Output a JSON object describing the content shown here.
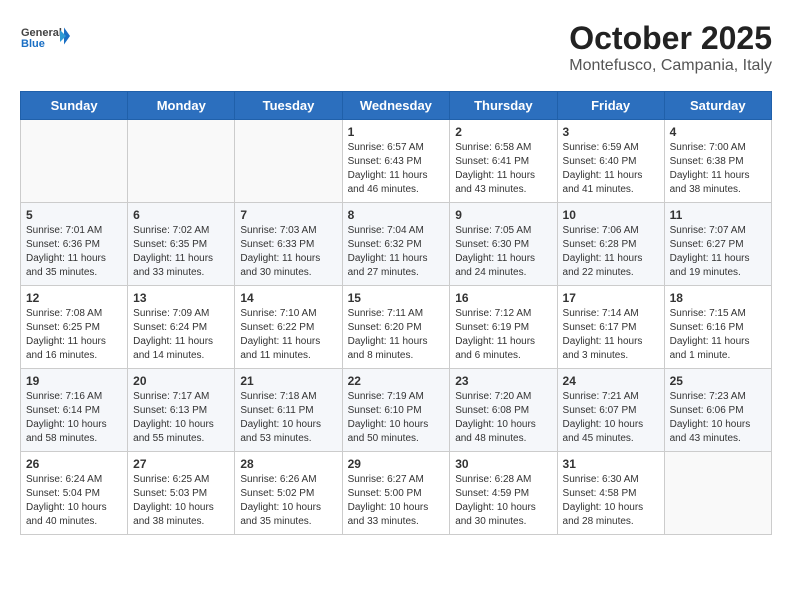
{
  "header": {
    "logo_general": "General",
    "logo_blue": "Blue",
    "title": "October 2025",
    "subtitle": "Montefusco, Campania, Italy"
  },
  "calendar": {
    "days_of_week": [
      "Sunday",
      "Monday",
      "Tuesday",
      "Wednesday",
      "Thursday",
      "Friday",
      "Saturday"
    ],
    "weeks": [
      [
        {
          "day": "",
          "info": ""
        },
        {
          "day": "",
          "info": ""
        },
        {
          "day": "",
          "info": ""
        },
        {
          "day": "1",
          "info": "Sunrise: 6:57 AM\nSunset: 6:43 PM\nDaylight: 11 hours and 46 minutes."
        },
        {
          "day": "2",
          "info": "Sunrise: 6:58 AM\nSunset: 6:41 PM\nDaylight: 11 hours and 43 minutes."
        },
        {
          "day": "3",
          "info": "Sunrise: 6:59 AM\nSunset: 6:40 PM\nDaylight: 11 hours and 41 minutes."
        },
        {
          "day": "4",
          "info": "Sunrise: 7:00 AM\nSunset: 6:38 PM\nDaylight: 11 hours and 38 minutes."
        }
      ],
      [
        {
          "day": "5",
          "info": "Sunrise: 7:01 AM\nSunset: 6:36 PM\nDaylight: 11 hours and 35 minutes."
        },
        {
          "day": "6",
          "info": "Sunrise: 7:02 AM\nSunset: 6:35 PM\nDaylight: 11 hours and 33 minutes."
        },
        {
          "day": "7",
          "info": "Sunrise: 7:03 AM\nSunset: 6:33 PM\nDaylight: 11 hours and 30 minutes."
        },
        {
          "day": "8",
          "info": "Sunrise: 7:04 AM\nSunset: 6:32 PM\nDaylight: 11 hours and 27 minutes."
        },
        {
          "day": "9",
          "info": "Sunrise: 7:05 AM\nSunset: 6:30 PM\nDaylight: 11 hours and 24 minutes."
        },
        {
          "day": "10",
          "info": "Sunrise: 7:06 AM\nSunset: 6:28 PM\nDaylight: 11 hours and 22 minutes."
        },
        {
          "day": "11",
          "info": "Sunrise: 7:07 AM\nSunset: 6:27 PM\nDaylight: 11 hours and 19 minutes."
        }
      ],
      [
        {
          "day": "12",
          "info": "Sunrise: 7:08 AM\nSunset: 6:25 PM\nDaylight: 11 hours and 16 minutes."
        },
        {
          "day": "13",
          "info": "Sunrise: 7:09 AM\nSunset: 6:24 PM\nDaylight: 11 hours and 14 minutes."
        },
        {
          "day": "14",
          "info": "Sunrise: 7:10 AM\nSunset: 6:22 PM\nDaylight: 11 hours and 11 minutes."
        },
        {
          "day": "15",
          "info": "Sunrise: 7:11 AM\nSunset: 6:20 PM\nDaylight: 11 hours and 8 minutes."
        },
        {
          "day": "16",
          "info": "Sunrise: 7:12 AM\nSunset: 6:19 PM\nDaylight: 11 hours and 6 minutes."
        },
        {
          "day": "17",
          "info": "Sunrise: 7:14 AM\nSunset: 6:17 PM\nDaylight: 11 hours and 3 minutes."
        },
        {
          "day": "18",
          "info": "Sunrise: 7:15 AM\nSunset: 6:16 PM\nDaylight: 11 hours and 1 minute."
        }
      ],
      [
        {
          "day": "19",
          "info": "Sunrise: 7:16 AM\nSunset: 6:14 PM\nDaylight: 10 hours and 58 minutes."
        },
        {
          "day": "20",
          "info": "Sunrise: 7:17 AM\nSunset: 6:13 PM\nDaylight: 10 hours and 55 minutes."
        },
        {
          "day": "21",
          "info": "Sunrise: 7:18 AM\nSunset: 6:11 PM\nDaylight: 10 hours and 53 minutes."
        },
        {
          "day": "22",
          "info": "Sunrise: 7:19 AM\nSunset: 6:10 PM\nDaylight: 10 hours and 50 minutes."
        },
        {
          "day": "23",
          "info": "Sunrise: 7:20 AM\nSunset: 6:08 PM\nDaylight: 10 hours and 48 minutes."
        },
        {
          "day": "24",
          "info": "Sunrise: 7:21 AM\nSunset: 6:07 PM\nDaylight: 10 hours and 45 minutes."
        },
        {
          "day": "25",
          "info": "Sunrise: 7:23 AM\nSunset: 6:06 PM\nDaylight: 10 hours and 43 minutes."
        }
      ],
      [
        {
          "day": "26",
          "info": "Sunrise: 6:24 AM\nSunset: 5:04 PM\nDaylight: 10 hours and 40 minutes."
        },
        {
          "day": "27",
          "info": "Sunrise: 6:25 AM\nSunset: 5:03 PM\nDaylight: 10 hours and 38 minutes."
        },
        {
          "day": "28",
          "info": "Sunrise: 6:26 AM\nSunset: 5:02 PM\nDaylight: 10 hours and 35 minutes."
        },
        {
          "day": "29",
          "info": "Sunrise: 6:27 AM\nSunset: 5:00 PM\nDaylight: 10 hours and 33 minutes."
        },
        {
          "day": "30",
          "info": "Sunrise: 6:28 AM\nSunset: 4:59 PM\nDaylight: 10 hours and 30 minutes."
        },
        {
          "day": "31",
          "info": "Sunrise: 6:30 AM\nSunset: 4:58 PM\nDaylight: 10 hours and 28 minutes."
        },
        {
          "day": "",
          "info": ""
        }
      ]
    ]
  }
}
